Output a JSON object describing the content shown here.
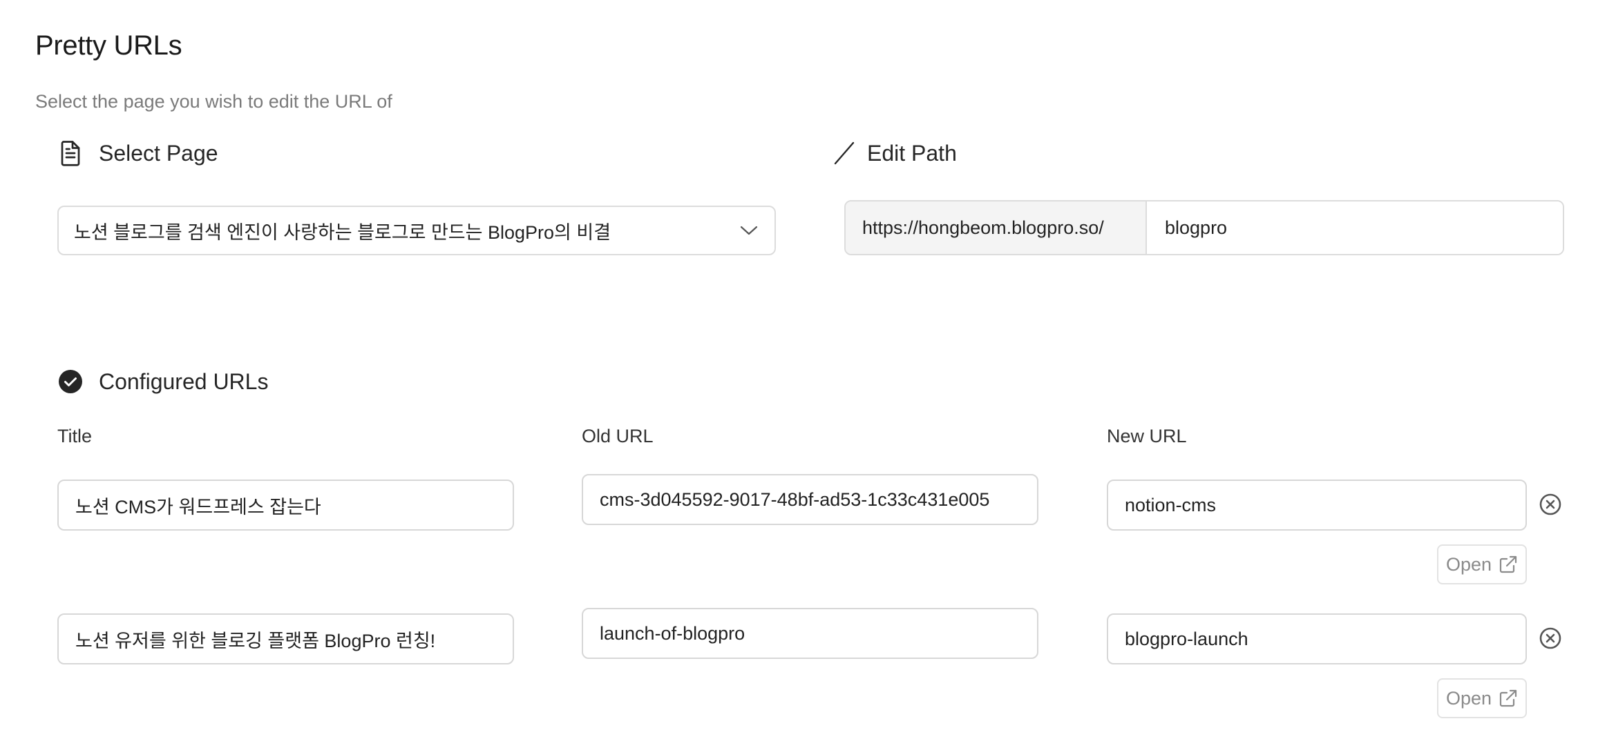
{
  "header": {
    "title": "Pretty URLs",
    "subtitle": "Select the page you wish to edit the URL of"
  },
  "select_page": {
    "label": "Select Page",
    "icon": "document-icon",
    "selected": "노션 블로그를 검색 엔진이 사랑하는 블로그로 만드는 BlogPro의 비결"
  },
  "edit_path": {
    "label": "Edit Path",
    "icon": "slash-icon",
    "prefix": "https://hongbeom.blogpro.so/",
    "value": "blogpro"
  },
  "configured": {
    "label": "Configured URLs",
    "icon": "check-circle-icon",
    "columns": {
      "title": "Title",
      "old_url": "Old URL",
      "new_url": "New URL"
    },
    "rows": [
      {
        "title": "노션 CMS가 워드프레스 잡는다",
        "old_url": "cms-3d045592-9017-48bf-ad53-1c33c431e005",
        "new_url": "notion-cms",
        "open_label": "Open"
      },
      {
        "title": "노션 유저를 위한 블로깅 플랫폼 BlogPro 런칭!",
        "old_url": "launch-of-blogpro",
        "new_url": "blogpro-launch",
        "open_label": "Open"
      }
    ]
  },
  "colors": {
    "border": "#dcdcdc",
    "prefix_bg": "#f4f4f4",
    "muted_text": "#7a7a7a",
    "icon_dark": "#262626"
  }
}
